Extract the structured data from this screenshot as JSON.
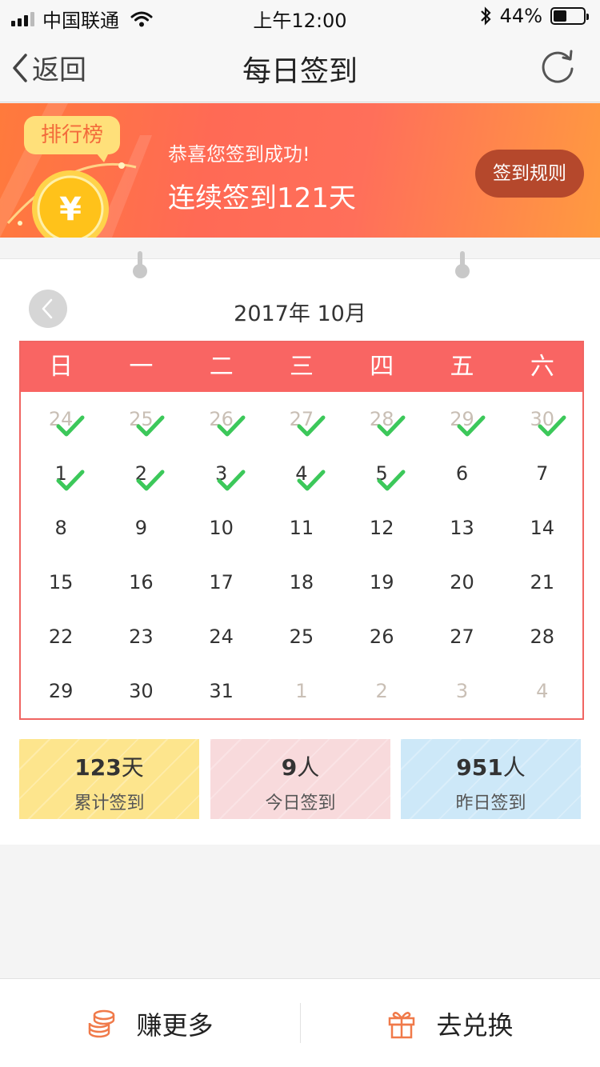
{
  "status_bar": {
    "carrier": "中国联通",
    "time": "上午12:00",
    "battery": "44%",
    "battery_level": 0.44,
    "icons": [
      "signal-icon",
      "wifi-icon",
      "bluetooth-icon",
      "battery-icon"
    ]
  },
  "nav": {
    "back_label": "返回",
    "title": "每日签到",
    "icons": [
      "chevron-left-icon",
      "refresh-icon"
    ]
  },
  "banner": {
    "rank_label": "排行榜",
    "sub_text": "恭喜您签到成功!",
    "main_text": "连续签到121天",
    "rules_label": "签到规则",
    "coin_symbol": "¥"
  },
  "calendar": {
    "title": "2017年 10月",
    "weekdays": [
      "日",
      "一",
      "二",
      "三",
      "四",
      "五",
      "六"
    ],
    "days": [
      {
        "num": "24",
        "other": true,
        "checked": true
      },
      {
        "num": "25",
        "other": true,
        "checked": true
      },
      {
        "num": "26",
        "other": true,
        "checked": true
      },
      {
        "num": "27",
        "other": true,
        "checked": true
      },
      {
        "num": "28",
        "other": true,
        "checked": true
      },
      {
        "num": "29",
        "other": true,
        "checked": true
      },
      {
        "num": "30",
        "other": true,
        "checked": true
      },
      {
        "num": "1",
        "other": false,
        "checked": true
      },
      {
        "num": "2",
        "other": false,
        "checked": true
      },
      {
        "num": "3",
        "other": false,
        "checked": true
      },
      {
        "num": "4",
        "other": false,
        "checked": true
      },
      {
        "num": "5",
        "other": false,
        "checked": true
      },
      {
        "num": "6",
        "other": false,
        "checked": false
      },
      {
        "num": "7",
        "other": false,
        "checked": false
      },
      {
        "num": "8",
        "other": false,
        "checked": false
      },
      {
        "num": "9",
        "other": false,
        "checked": false
      },
      {
        "num": "10",
        "other": false,
        "checked": false
      },
      {
        "num": "11",
        "other": false,
        "checked": false
      },
      {
        "num": "12",
        "other": false,
        "checked": false
      },
      {
        "num": "13",
        "other": false,
        "checked": false
      },
      {
        "num": "14",
        "other": false,
        "checked": false
      },
      {
        "num": "15",
        "other": false,
        "checked": false
      },
      {
        "num": "16",
        "other": false,
        "checked": false
      },
      {
        "num": "17",
        "other": false,
        "checked": false
      },
      {
        "num": "18",
        "other": false,
        "checked": false
      },
      {
        "num": "19",
        "other": false,
        "checked": false
      },
      {
        "num": "20",
        "other": false,
        "checked": false
      },
      {
        "num": "21",
        "other": false,
        "checked": false
      },
      {
        "num": "22",
        "other": false,
        "checked": false
      },
      {
        "num": "23",
        "other": false,
        "checked": false
      },
      {
        "num": "24",
        "other": false,
        "checked": false
      },
      {
        "num": "25",
        "other": false,
        "checked": false
      },
      {
        "num": "26",
        "other": false,
        "checked": false
      },
      {
        "num": "27",
        "other": false,
        "checked": false
      },
      {
        "num": "28",
        "other": false,
        "checked": false
      },
      {
        "num": "29",
        "other": false,
        "checked": false
      },
      {
        "num": "30",
        "other": false,
        "checked": false
      },
      {
        "num": "31",
        "other": false,
        "checked": false
      },
      {
        "num": "1",
        "other": true,
        "checked": false
      },
      {
        "num": "2",
        "other": true,
        "checked": false
      },
      {
        "num": "3",
        "other": true,
        "checked": false
      },
      {
        "num": "4",
        "other": true,
        "checked": false
      }
    ]
  },
  "stats": [
    {
      "value": "123",
      "unit": "天",
      "label": "累计签到",
      "color": "#fde58d"
    },
    {
      "value": "9",
      "unit": "人",
      "label": "今日签到",
      "color": "#f8dadc"
    },
    {
      "value": "951",
      "unit": "人",
      "label": "昨日签到",
      "color": "#cde8f8"
    }
  ],
  "bottom": {
    "earn_label": "赚更多",
    "exchange_label": "去兑换",
    "icons": [
      "coins-icon",
      "gift-icon"
    ]
  },
  "colors": {
    "accent": "#f96563",
    "check": "#3cc85a",
    "rules_button": "#b5482c"
  }
}
